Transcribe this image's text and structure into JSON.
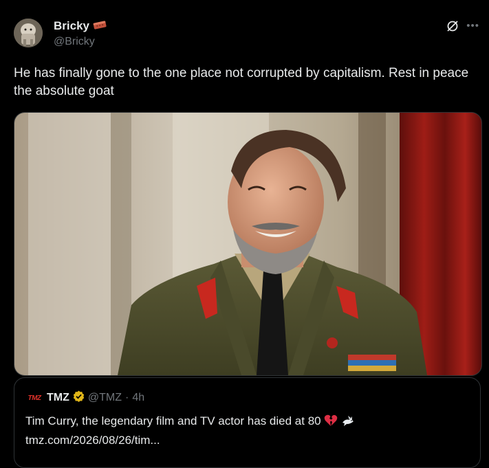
{
  "tweet": {
    "display_name": "Bricky",
    "handle": "@Bricky",
    "name_emoji_icon": "brick-icon",
    "text": "He has finally gone to the one place not corrupted by capitalism. Rest in peace the absolute goat",
    "media_icon": "portrait-photo-icon"
  },
  "quoted_tweet": {
    "logo_text": "TMZ",
    "display_name": "TMZ",
    "handle": "@TMZ",
    "separator": "·",
    "time": "4h",
    "text": "Tim Curry, the legendary film and TV actor has died at 80",
    "link": "tmz.com/2026/08/26/tim...",
    "emojis": [
      "broken-heart-icon",
      "dove-icon"
    ]
  },
  "colors": {
    "background": "#000000",
    "text_primary": "#e7e9ea",
    "text_secondary": "#71767b",
    "border": "#2f3336",
    "verified_gold": "#e2b719",
    "tmz_red": "#e0322a"
  }
}
